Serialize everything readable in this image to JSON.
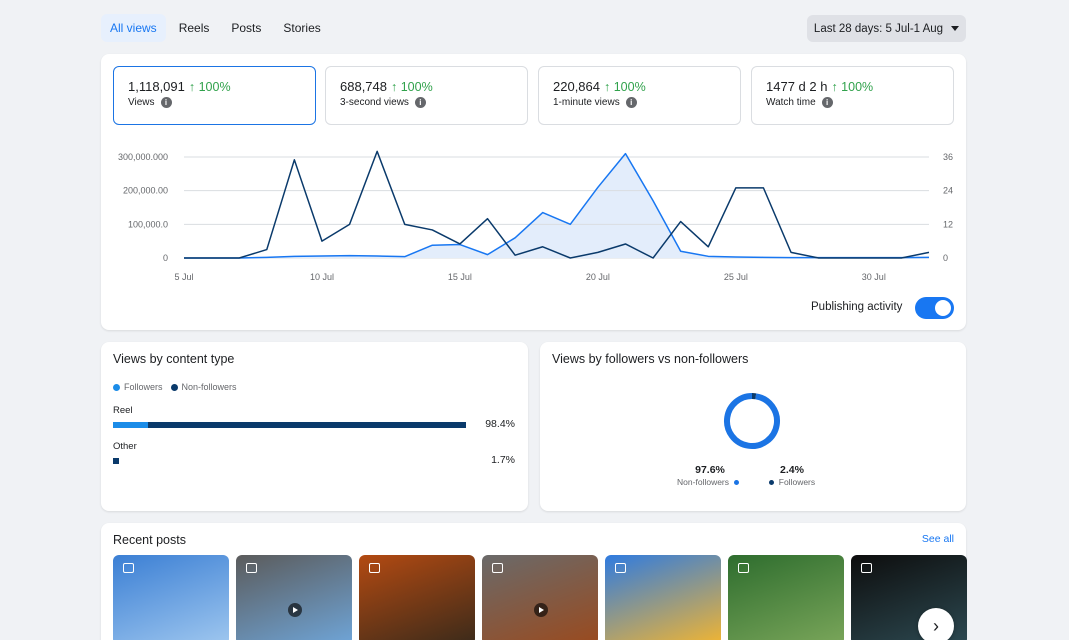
{
  "tabs": [
    {
      "label": "All views",
      "active": true
    },
    {
      "label": "Reels",
      "active": false
    },
    {
      "label": "Posts",
      "active": false
    },
    {
      "label": "Stories",
      "active": false
    }
  ],
  "date_range": {
    "label": "Last 28 days: 5 Jul-1 Aug"
  },
  "metrics": [
    {
      "value": "1,118,091",
      "change": "↑ 100%",
      "label": "Views",
      "active": true
    },
    {
      "value": "688,748",
      "change": "↑ 100%",
      "label": "3-second views",
      "active": false
    },
    {
      "value": "220,864",
      "change": "↑ 100%",
      "label": "1-minute views",
      "active": false
    },
    {
      "value": "1477 d 2 h",
      "change": "↑ 100%",
      "label": "Watch time",
      "active": false
    }
  ],
  "chart_data": {
    "type": "line",
    "x_ticks": [
      "5 Jul",
      "10 Jul",
      "15 Jul",
      "20 Jul",
      "25 Jul",
      "30 Jul"
    ],
    "x": [
      "5 Jul",
      "6 Jul",
      "7 Jul",
      "8 Jul",
      "9 Jul",
      "10 Jul",
      "11 Jul",
      "12 Jul",
      "13 Jul",
      "14 Jul",
      "15 Jul",
      "16 Jul",
      "17 Jul",
      "18 Jul",
      "19 Jul",
      "20 Jul",
      "21 Jul",
      "22 Jul",
      "23 Jul",
      "24 Jul",
      "25 Jul",
      "26 Jul",
      "27 Jul",
      "28 Jul",
      "29 Jul",
      "30 Jul",
      "31 Jul",
      "1 Aug"
    ],
    "y_left_ticks": [
      "0",
      "100,000.0",
      "200,000.00",
      "300,000.000"
    ],
    "y_right_ticks": [
      "0",
      "12",
      "24",
      "36"
    ],
    "ylim_left": [
      0,
      300000
    ],
    "ylim_right": [
      0,
      36
    ],
    "series": [
      {
        "axis": "left",
        "color": "#1877f2",
        "fill": "#e3edfb",
        "values": [
          0,
          0,
          0,
          2000,
          5000,
          6000,
          7000,
          6000,
          4000,
          38000,
          40000,
          10000,
          60000,
          135000,
          100000,
          210000,
          310000,
          170000,
          20000,
          5000,
          3000,
          2000,
          1000,
          1000,
          1000,
          1000,
          1000,
          2000
        ]
      },
      {
        "axis": "right",
        "color": "#0a3a6b",
        "values": [
          0,
          0,
          0,
          3,
          35,
          6,
          12,
          38,
          12,
          10,
          5,
          14,
          1,
          4,
          0,
          2,
          5,
          0,
          13,
          4,
          25,
          25,
          2,
          0,
          0,
          0,
          0,
          2
        ]
      }
    ]
  },
  "publishing": {
    "label": "Publishing activity",
    "enabled": true
  },
  "content_type": {
    "title": "Views by content type",
    "legend": [
      "Followers",
      "Non-followers"
    ],
    "colors": {
      "followers": "#1b8ce8",
      "non_followers": "#0a3a6b"
    },
    "rows": [
      {
        "label": "Reel",
        "percent": "98.4%",
        "share": 0.984,
        "followers_share": 0.02
      },
      {
        "label": "Other",
        "percent": "1.7%",
        "share": 0.017,
        "followers_share": 0
      }
    ]
  },
  "followers": {
    "title": "Views by followers vs non-followers",
    "non_followers": {
      "percent": "97.6%",
      "label": "Non-followers",
      "share": 0.976
    },
    "followers": {
      "percent": "2.4%",
      "label": "Followers",
      "share": 0.024
    }
  },
  "recent": {
    "title": "Recent posts",
    "see_all": "See all",
    "posts": [
      {
        "type": "reel",
        "colors": [
          "#3b7fd4",
          "#9fc7ef"
        ]
      },
      {
        "type": "video",
        "colors": [
          "#5b5b5b",
          "#6fa5d8"
        ]
      },
      {
        "type": "reel",
        "colors": [
          "#b34a12",
          "#3a2a1a"
        ]
      },
      {
        "type": "video",
        "colors": [
          "#6a6a6a",
          "#9a4a1e"
        ]
      },
      {
        "type": "reel",
        "colors": [
          "#2f7be0",
          "#f2b531"
        ]
      },
      {
        "type": "reel",
        "colors": [
          "#2e6d2e",
          "#7aa65a"
        ]
      },
      {
        "type": "reel",
        "colors": [
          "#0d0d0d",
          "#2d4a52"
        ]
      }
    ]
  }
}
